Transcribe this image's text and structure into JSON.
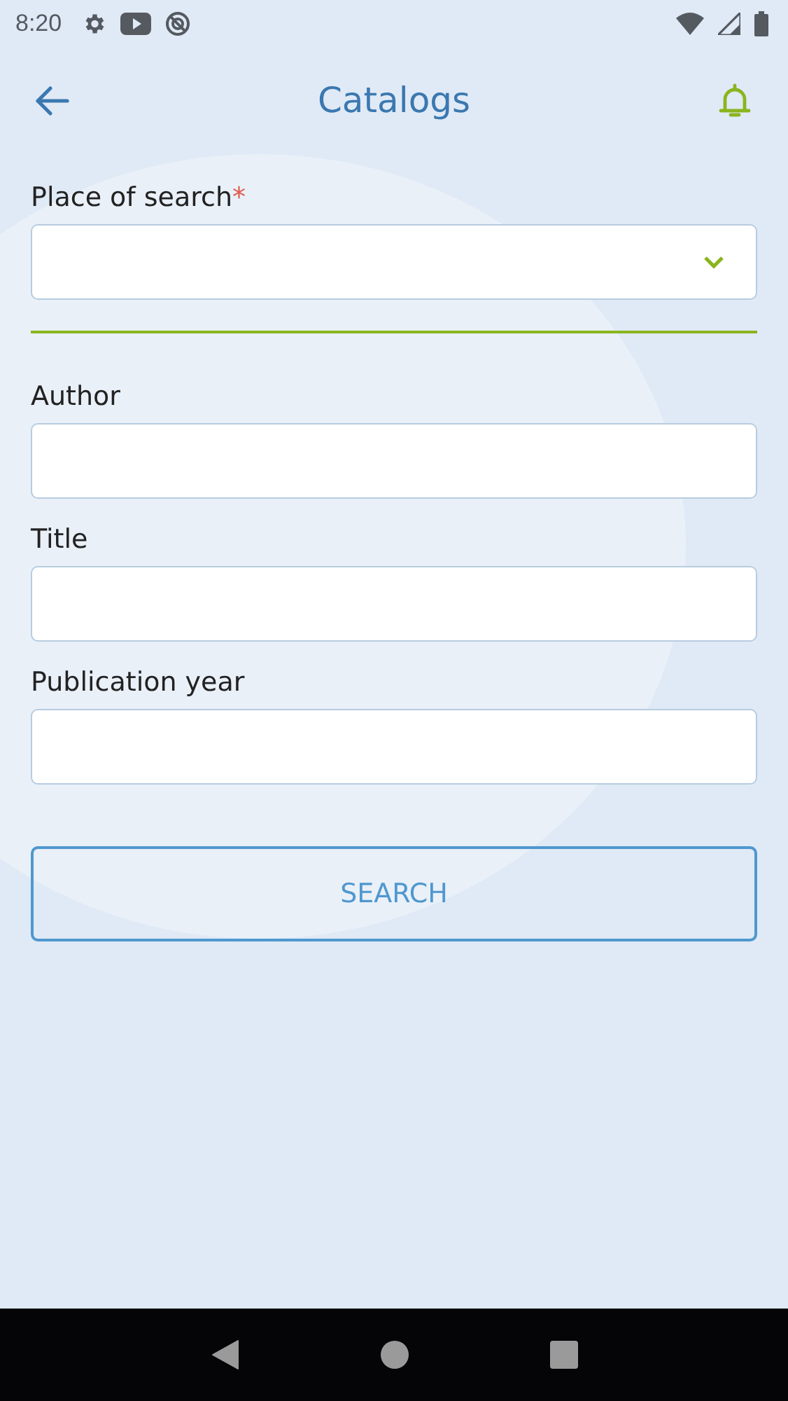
{
  "status_bar": {
    "time": "8:20"
  },
  "header": {
    "title": "Catalogs"
  },
  "fields": [
    {
      "kind": "select",
      "label": "Place of search",
      "required_mark": "*"
    },
    {
      "kind": "text",
      "label": "Author"
    },
    {
      "kind": "text",
      "label": "Title"
    },
    {
      "kind": "text",
      "label": "Publication year"
    }
  ],
  "search_button": {
    "label": "SEARCH"
  }
}
